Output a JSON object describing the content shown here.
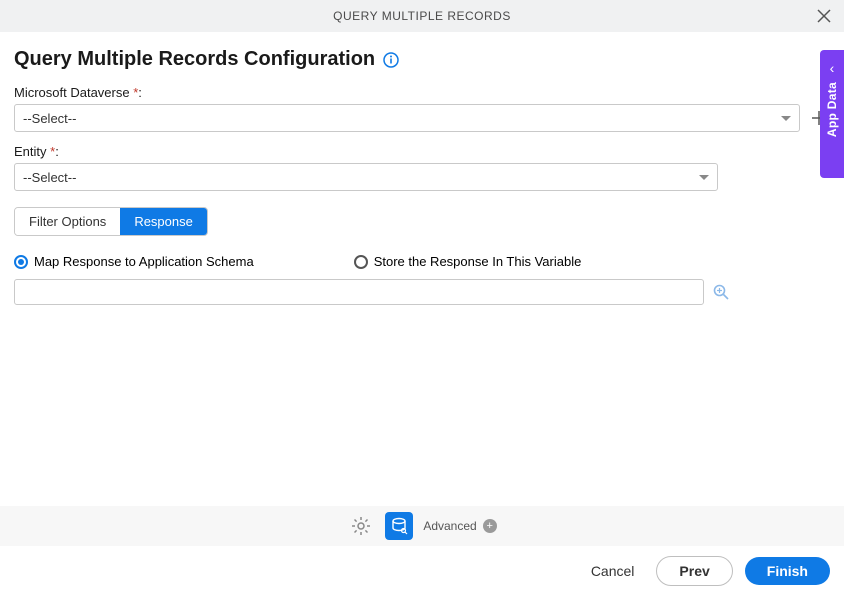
{
  "header": {
    "title": "QUERY MULTIPLE RECORDS"
  },
  "page_title": "Query Multiple Records Configuration",
  "fields": {
    "dataverse": {
      "label": "Microsoft Dataverse ",
      "required_marker": "*",
      "value": "--Select--"
    },
    "entity": {
      "label": "Entity ",
      "required_marker": "*",
      "value": "--Select--"
    }
  },
  "tabs": {
    "filter": "Filter Options",
    "response": "Response"
  },
  "response_panel": {
    "radio_map": "Map Response to Application Schema",
    "radio_store": "Store the Response In This Variable",
    "input_value": ""
  },
  "side_panel": {
    "label": "App Data"
  },
  "toolbar": {
    "advanced": "Advanced"
  },
  "footer": {
    "cancel": "Cancel",
    "prev": "Prev",
    "finish": "Finish"
  }
}
